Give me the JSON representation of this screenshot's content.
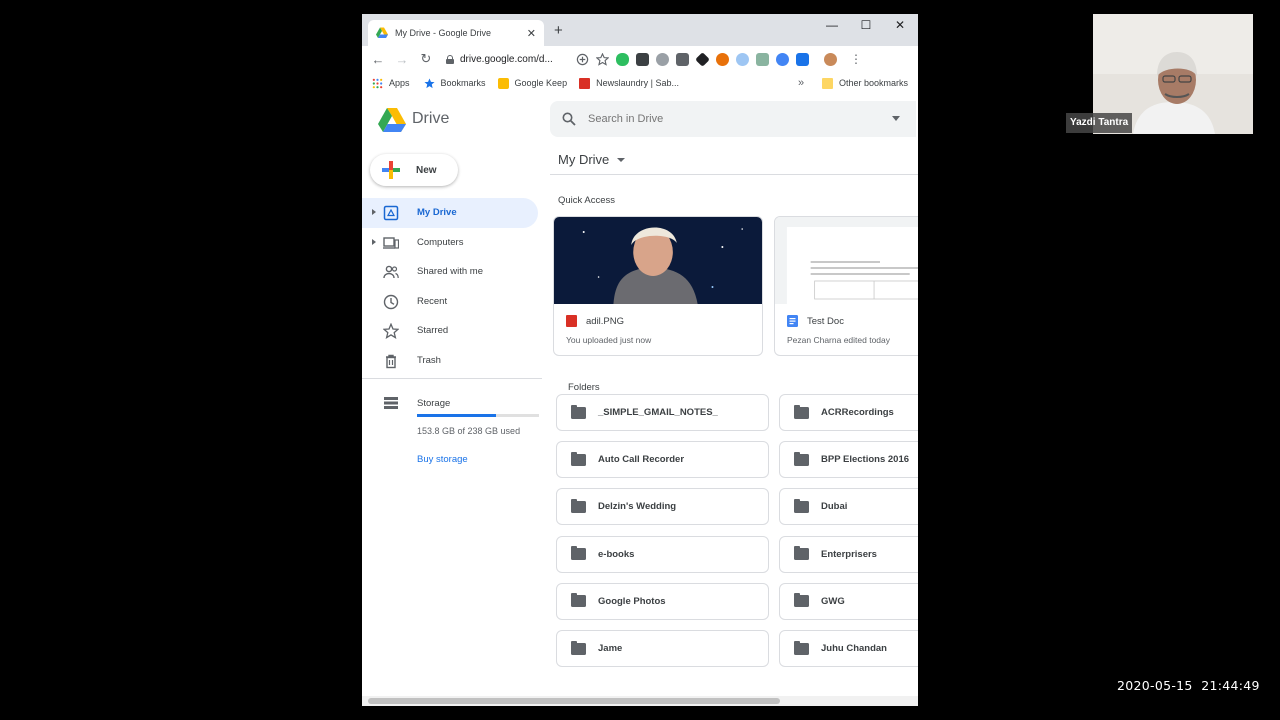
{
  "browser": {
    "tab_title": "My Drive - Google Drive",
    "new_tab_symbol": "+",
    "url": "drive.google.com/d...",
    "bookmarks": [
      {
        "label": "Apps"
      },
      {
        "label": "Bookmarks"
      },
      {
        "label": "Google Keep"
      },
      {
        "label": "Newslaundry | Sab..."
      }
    ],
    "other_bookmarks": "Other bookmarks"
  },
  "drive": {
    "app_name": "Drive",
    "search_placeholder": "Search in Drive",
    "new_label": "New",
    "nav_items": [
      {
        "label": "My Drive"
      },
      {
        "label": "Computers"
      },
      {
        "label": "Shared with me"
      },
      {
        "label": "Recent"
      },
      {
        "label": "Starred"
      },
      {
        "label": "Trash"
      }
    ],
    "storage": {
      "label": "Storage",
      "used_text": "153.8 GB of 238 GB used",
      "used_fraction": 0.646,
      "buy_label": "Buy storage"
    },
    "breadcrumb": "My Drive",
    "quick_access": {
      "label": "Quick Access",
      "cards": [
        {
          "name": "adil.PNG",
          "sub": "You uploaded just now",
          "icon": "image-file-icon"
        },
        {
          "name": "Test Doc",
          "sub": "Pezan Charna edited today",
          "icon": "doc-file-icon"
        }
      ]
    },
    "folders_label": "Folders",
    "folders": [
      "_SIMPLE_GMAIL_NOTES_",
      "ACRRecordings",
      "Auto Call Recorder",
      "BPP Elections 2016",
      "Delzin's Wedding",
      "Dubai",
      "e-books",
      "Enterprisers",
      "Google Photos",
      "GWG",
      "Jame",
      "Juhu Chandan"
    ]
  },
  "meeting": {
    "participant_name": "Yazdi Tantra",
    "timestamp": "2020-05-15  21:44:49"
  },
  "colors": {
    "accent": "#1a73e8",
    "active_nav_bg": "#e8f0fe"
  }
}
